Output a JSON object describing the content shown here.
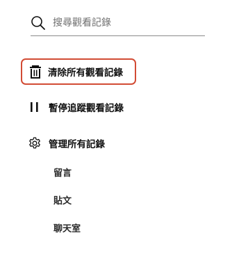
{
  "search": {
    "placeholder": "搜尋觀看記錄",
    "icon": "search-icon"
  },
  "actions": [
    {
      "label": "清除所有觀看記錄",
      "icon": "trash-icon"
    },
    {
      "label": "暫停追蹤觀看記錄",
      "icon": "pause-icon"
    },
    {
      "label": "管理所有記錄",
      "icon": "gear-icon"
    }
  ],
  "manage_subitems": [
    "留言",
    "貼文",
    "聊天室"
  ],
  "colors": {
    "highlight_border": "#d24b34",
    "text": "#0f0f0f",
    "placeholder": "#6f6f6f",
    "divider": "#8a8a8a"
  }
}
